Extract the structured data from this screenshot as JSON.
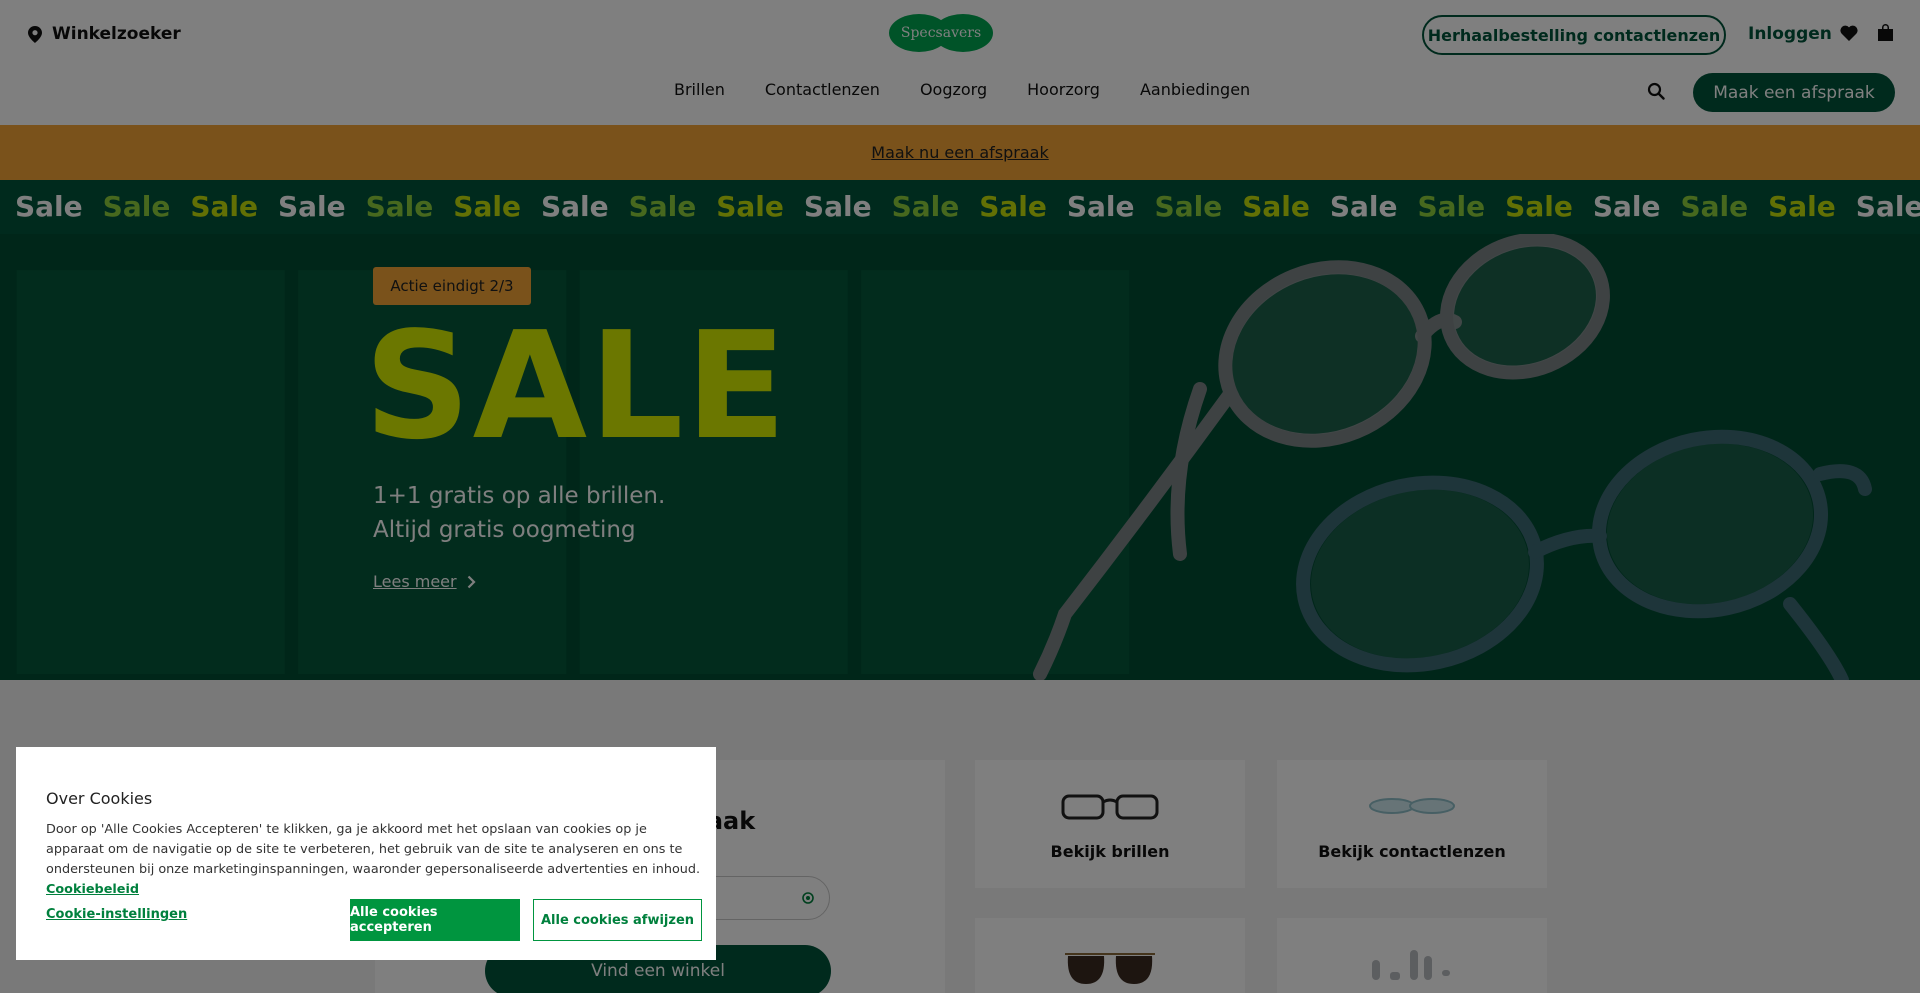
{
  "header": {
    "store_finder": "Winkelzoeker",
    "logo_text": "Specsavers",
    "reorder_contacts": "Herhaalbestelling contactlenzen",
    "login": "Inloggen",
    "nav": [
      "Brillen",
      "Contactlenzen",
      "Oogzorg",
      "Hoorzorg",
      "Aanbiedingen"
    ],
    "make_appointment": "Maak een afspraak"
  },
  "promo_strip": {
    "link": "Maak nu een afspraak"
  },
  "ticker": {
    "items": [
      "Sale",
      "Sale",
      "Sale",
      "Sale",
      "Sale",
      "Sale",
      "Sale",
      "Sale",
      "Sale",
      "Sale",
      "Sale",
      "Sale",
      "Sale",
      "Sale",
      "Sale",
      "Sale",
      "Sale",
      "Sale",
      "Sale",
      "Sale",
      "Sale",
      "Sale",
      "Sale",
      "Sale",
      "Sale"
    ],
    "colors": [
      "white",
      "lime",
      "yellow"
    ]
  },
  "hero": {
    "badge": "Actie eindigt 2/3",
    "title": "SALE",
    "line1": "1+1 gratis op alle brillen.",
    "line2": "Altijd gratis oogmeting",
    "link": "Lees meer"
  },
  "lower": {
    "appointment_title": "raak",
    "find_store_button": "Vind een winkel",
    "tiles": [
      {
        "label": "Bekijk brillen",
        "icon": "glasses-icon"
      },
      {
        "label": "Bekijk contactlenzen",
        "icon": "contact-lens-icon"
      },
      {
        "label": "",
        "icon": "sunglasses-icon"
      },
      {
        "label": "",
        "icon": "hearing-aids-icon"
      }
    ]
  },
  "cookie_dialog": {
    "title": "Over Cookies",
    "body": "Door op 'Alle Cookies Accepteren' te klikken, ga je akkoord met het opslaan van cookies op je apparaat om de navigatie op de site te verbeteren, het gebruik van de site te analyseren en ons te ondersteunen bij onze marketinginspanningen, waaronder gepersonaliseerde advertenties en inhoud.",
    "policy_link": "Cookiebeleid",
    "settings_link": "Cookie-instellingen",
    "accept_button": "Alle cookies accepteren",
    "reject_button": "Alle cookies afwijzen"
  },
  "colors": {
    "brand_green": "#00553a",
    "logo_green": "#00a651",
    "promo_orange": "#f5a536",
    "sale_yellow": "#d6ef00",
    "cookie_green": "#00953f"
  }
}
